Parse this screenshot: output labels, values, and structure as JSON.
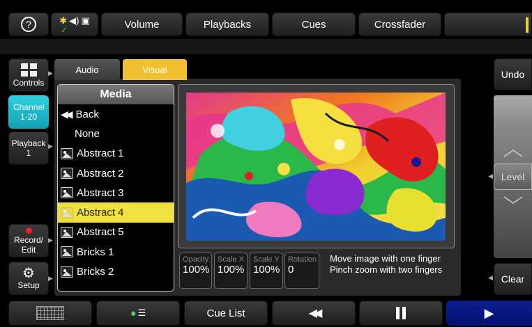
{
  "topbar": {
    "help_icon": "help-circle-icon",
    "status_icons": [
      "sun-icon",
      "speaker-icon",
      "image-icon"
    ],
    "tabs": [
      "Volume",
      "Playbacks",
      "Cues",
      "Crossfader"
    ]
  },
  "sidebar": {
    "controls": "Controls",
    "channel": "Channel 1-20",
    "playback": "Playback 1",
    "record_edit": "Record/ Edit",
    "setup": "Setup"
  },
  "tabs": {
    "audio": "Audio",
    "visual": "Visual"
  },
  "media": {
    "title": "Media",
    "back": "Back",
    "none": "None",
    "items": [
      "Abstract 1",
      "Abstract 2",
      "Abstract 3",
      "Abstract 4",
      "Abstract 5",
      "Bricks 1",
      "Bricks 2"
    ],
    "selected_index": 3
  },
  "params": {
    "opacity_label": "Opacity",
    "opacity_value": "100%",
    "scalex_label": "Scale X",
    "scalex_value": "100%",
    "scaley_label": "Scale Y",
    "scaley_value": "100%",
    "rotation_label": "Rotation",
    "rotation_value": "0"
  },
  "hint": {
    "line1": "Move image with one finger",
    "line2": "Pinch zoom with two fingers"
  },
  "right": {
    "undo": "Undo",
    "level": "Level",
    "clear": "Clear"
  },
  "bottom": {
    "cue_list": "Cue List"
  },
  "colors": {
    "accent_yellow": "#f0d040",
    "channel_cyan": "#18b8c8",
    "go_blue": "#0a1a80"
  }
}
